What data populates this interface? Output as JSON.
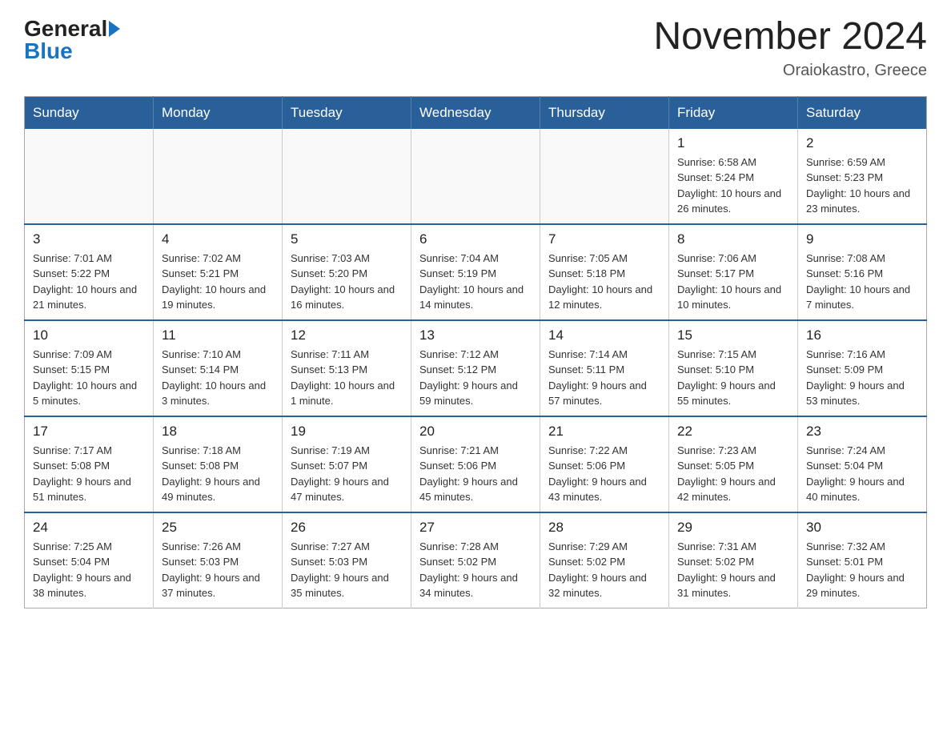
{
  "header": {
    "logo_general": "General",
    "logo_blue": "Blue",
    "title": "November 2024",
    "location": "Oraiokastro, Greece"
  },
  "days_of_week": [
    "Sunday",
    "Monday",
    "Tuesday",
    "Wednesday",
    "Thursday",
    "Friday",
    "Saturday"
  ],
  "weeks": [
    [
      {
        "day": "",
        "info": ""
      },
      {
        "day": "",
        "info": ""
      },
      {
        "day": "",
        "info": ""
      },
      {
        "day": "",
        "info": ""
      },
      {
        "day": "",
        "info": ""
      },
      {
        "day": "1",
        "info": "Sunrise: 6:58 AM\nSunset: 5:24 PM\nDaylight: 10 hours and 26 minutes."
      },
      {
        "day": "2",
        "info": "Sunrise: 6:59 AM\nSunset: 5:23 PM\nDaylight: 10 hours and 23 minutes."
      }
    ],
    [
      {
        "day": "3",
        "info": "Sunrise: 7:01 AM\nSunset: 5:22 PM\nDaylight: 10 hours and 21 minutes."
      },
      {
        "day": "4",
        "info": "Sunrise: 7:02 AM\nSunset: 5:21 PM\nDaylight: 10 hours and 19 minutes."
      },
      {
        "day": "5",
        "info": "Sunrise: 7:03 AM\nSunset: 5:20 PM\nDaylight: 10 hours and 16 minutes."
      },
      {
        "day": "6",
        "info": "Sunrise: 7:04 AM\nSunset: 5:19 PM\nDaylight: 10 hours and 14 minutes."
      },
      {
        "day": "7",
        "info": "Sunrise: 7:05 AM\nSunset: 5:18 PM\nDaylight: 10 hours and 12 minutes."
      },
      {
        "day": "8",
        "info": "Sunrise: 7:06 AM\nSunset: 5:17 PM\nDaylight: 10 hours and 10 minutes."
      },
      {
        "day": "9",
        "info": "Sunrise: 7:08 AM\nSunset: 5:16 PM\nDaylight: 10 hours and 7 minutes."
      }
    ],
    [
      {
        "day": "10",
        "info": "Sunrise: 7:09 AM\nSunset: 5:15 PM\nDaylight: 10 hours and 5 minutes."
      },
      {
        "day": "11",
        "info": "Sunrise: 7:10 AM\nSunset: 5:14 PM\nDaylight: 10 hours and 3 minutes."
      },
      {
        "day": "12",
        "info": "Sunrise: 7:11 AM\nSunset: 5:13 PM\nDaylight: 10 hours and 1 minute."
      },
      {
        "day": "13",
        "info": "Sunrise: 7:12 AM\nSunset: 5:12 PM\nDaylight: 9 hours and 59 minutes."
      },
      {
        "day": "14",
        "info": "Sunrise: 7:14 AM\nSunset: 5:11 PM\nDaylight: 9 hours and 57 minutes."
      },
      {
        "day": "15",
        "info": "Sunrise: 7:15 AM\nSunset: 5:10 PM\nDaylight: 9 hours and 55 minutes."
      },
      {
        "day": "16",
        "info": "Sunrise: 7:16 AM\nSunset: 5:09 PM\nDaylight: 9 hours and 53 minutes."
      }
    ],
    [
      {
        "day": "17",
        "info": "Sunrise: 7:17 AM\nSunset: 5:08 PM\nDaylight: 9 hours and 51 minutes."
      },
      {
        "day": "18",
        "info": "Sunrise: 7:18 AM\nSunset: 5:08 PM\nDaylight: 9 hours and 49 minutes."
      },
      {
        "day": "19",
        "info": "Sunrise: 7:19 AM\nSunset: 5:07 PM\nDaylight: 9 hours and 47 minutes."
      },
      {
        "day": "20",
        "info": "Sunrise: 7:21 AM\nSunset: 5:06 PM\nDaylight: 9 hours and 45 minutes."
      },
      {
        "day": "21",
        "info": "Sunrise: 7:22 AM\nSunset: 5:06 PM\nDaylight: 9 hours and 43 minutes."
      },
      {
        "day": "22",
        "info": "Sunrise: 7:23 AM\nSunset: 5:05 PM\nDaylight: 9 hours and 42 minutes."
      },
      {
        "day": "23",
        "info": "Sunrise: 7:24 AM\nSunset: 5:04 PM\nDaylight: 9 hours and 40 minutes."
      }
    ],
    [
      {
        "day": "24",
        "info": "Sunrise: 7:25 AM\nSunset: 5:04 PM\nDaylight: 9 hours and 38 minutes."
      },
      {
        "day": "25",
        "info": "Sunrise: 7:26 AM\nSunset: 5:03 PM\nDaylight: 9 hours and 37 minutes."
      },
      {
        "day": "26",
        "info": "Sunrise: 7:27 AM\nSunset: 5:03 PM\nDaylight: 9 hours and 35 minutes."
      },
      {
        "day": "27",
        "info": "Sunrise: 7:28 AM\nSunset: 5:02 PM\nDaylight: 9 hours and 34 minutes."
      },
      {
        "day": "28",
        "info": "Sunrise: 7:29 AM\nSunset: 5:02 PM\nDaylight: 9 hours and 32 minutes."
      },
      {
        "day": "29",
        "info": "Sunrise: 7:31 AM\nSunset: 5:02 PM\nDaylight: 9 hours and 31 minutes."
      },
      {
        "day": "30",
        "info": "Sunrise: 7:32 AM\nSunset: 5:01 PM\nDaylight: 9 hours and 29 minutes."
      }
    ]
  ]
}
